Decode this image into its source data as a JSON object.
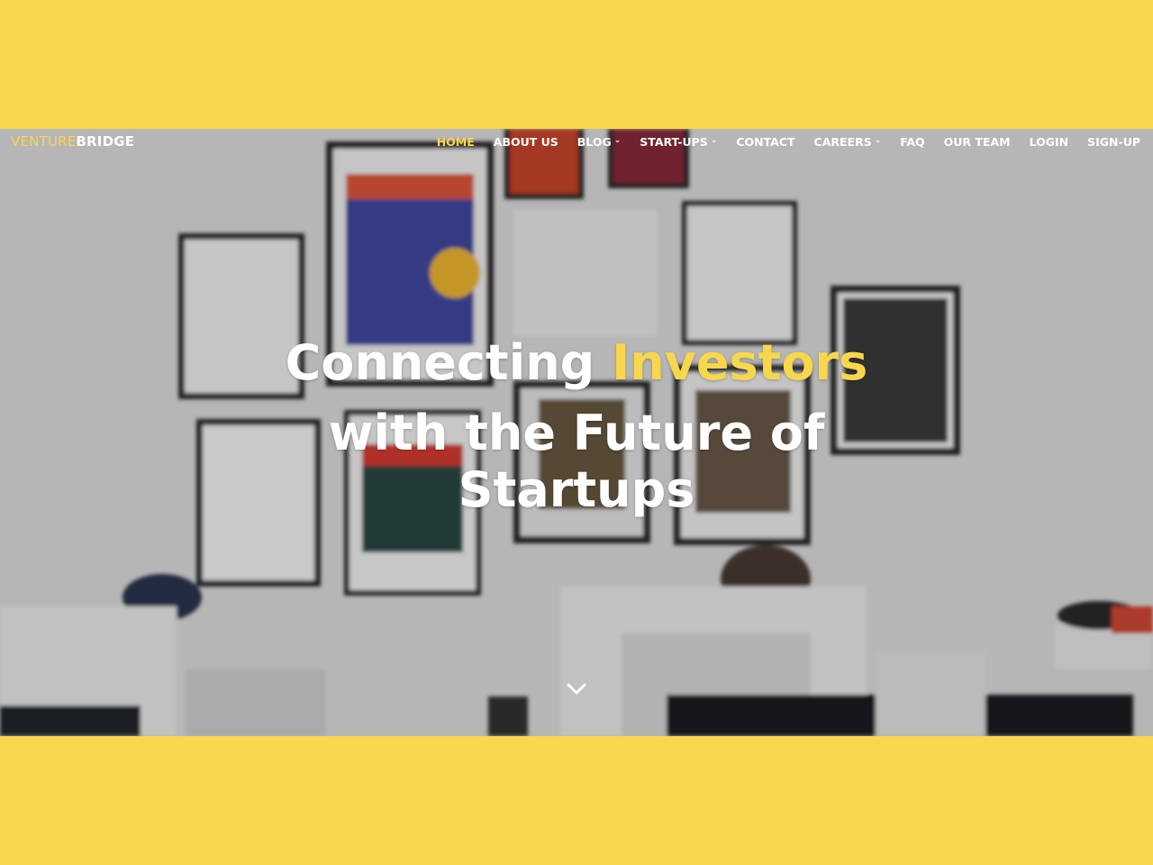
{
  "brand": {
    "part1": "VENTURE",
    "part2": "BRIDGE"
  },
  "nav": {
    "items": [
      {
        "label": "HOME",
        "active": true,
        "dropdown": false
      },
      {
        "label": "ABOUT US",
        "active": false,
        "dropdown": false
      },
      {
        "label": "BLOG",
        "active": false,
        "dropdown": true
      },
      {
        "label": "START-UPS",
        "active": false,
        "dropdown": true
      },
      {
        "label": "CONTACT",
        "active": false,
        "dropdown": false
      },
      {
        "label": "CAREERS",
        "active": false,
        "dropdown": true
      },
      {
        "label": "FAQ",
        "active": false,
        "dropdown": false
      },
      {
        "label": "OUR TEAM",
        "active": false,
        "dropdown": false
      },
      {
        "label": "LOGIN",
        "active": false,
        "dropdown": false
      },
      {
        "label": "SIGN-UP",
        "active": false,
        "dropdown": false
      }
    ]
  },
  "hero": {
    "line1_white": "Connecting ",
    "line1_yellow": "Investors",
    "line2_white": "with the Future of",
    "line3_yellow": "Startups",
    "scroll_icon": "chevron-down-icon"
  },
  "colors": {
    "accent": "#f8d74c",
    "text": "#ffffff"
  }
}
